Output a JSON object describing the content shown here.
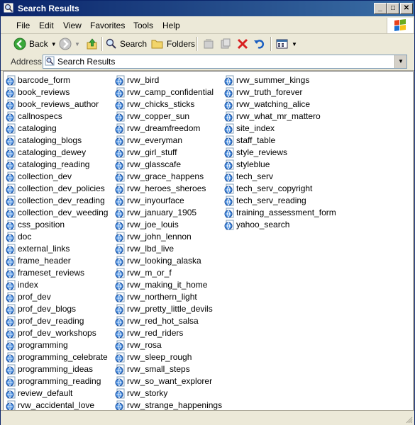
{
  "window": {
    "title": "Search Results"
  },
  "menu": [
    "File",
    "Edit",
    "View",
    "Favorites",
    "Tools",
    "Help"
  ],
  "toolbar": {
    "back_label": "Back",
    "search_label": "Search",
    "folders_label": "Folders"
  },
  "address": {
    "label": "Address",
    "value": "Search Results"
  },
  "files": {
    "col1": [
      "barcode_form",
      "book_reviews",
      "book_reviews_author",
      "callnospecs",
      "cataloging",
      "cataloging_blogs",
      "cataloging_dewey",
      "cataloging_reading",
      "collection_dev",
      "collection_dev_policies",
      "collection_dev_reading",
      "collection_dev_weeding",
      "css_position",
      "doc",
      "external_links",
      "frame_header",
      "frameset_reviews",
      "index",
      "prof_dev",
      "prof_dev_blogs",
      "prof_dev_reading",
      "prof_dev_workshops",
      "programming",
      "programming_celebrate",
      "programming_ideas",
      "programming_reading",
      "review_default",
      "rvw_accidental_love"
    ],
    "col2": [
      "rvw_bird",
      "rvw_camp_confidential",
      "rvw_chicks_sticks",
      "rvw_copper_sun",
      "rvw_dreamfreedom",
      "rvw_everyman",
      "rvw_girl_stuff",
      "rvw_glasscafe",
      "rvw_grace_happens",
      "rvw_heroes_sheroes",
      "rvw_inyourface",
      "rvw_january_1905",
      "rvw_joe_louis",
      "rvw_john_lennon",
      "rvw_lbd_live",
      "rvw_looking_alaska",
      "rvw_m_or_f",
      "rvw_making_it_home",
      "rvw_northern_light",
      "rvw_pretty_little_devils",
      "rvw_red_hot_salsa",
      "rvw_red_riders",
      "rvw_rosa",
      "rvw_sleep_rough",
      "rvw_small_steps",
      "rvw_so_want_explorer",
      "rvw_storky",
      "rvw_strange_happenings"
    ],
    "col3": [
      "rvw_summer_kings",
      "rvw_truth_forever",
      "rvw_watching_alice",
      "rvw_what_mr_mattero",
      "site_index",
      "staff_table",
      "style_reviews",
      "styleblue",
      "tech_serv",
      "tech_serv_copyright",
      "tech_serv_reading",
      "training_assessment_form",
      "yahoo_search"
    ]
  }
}
